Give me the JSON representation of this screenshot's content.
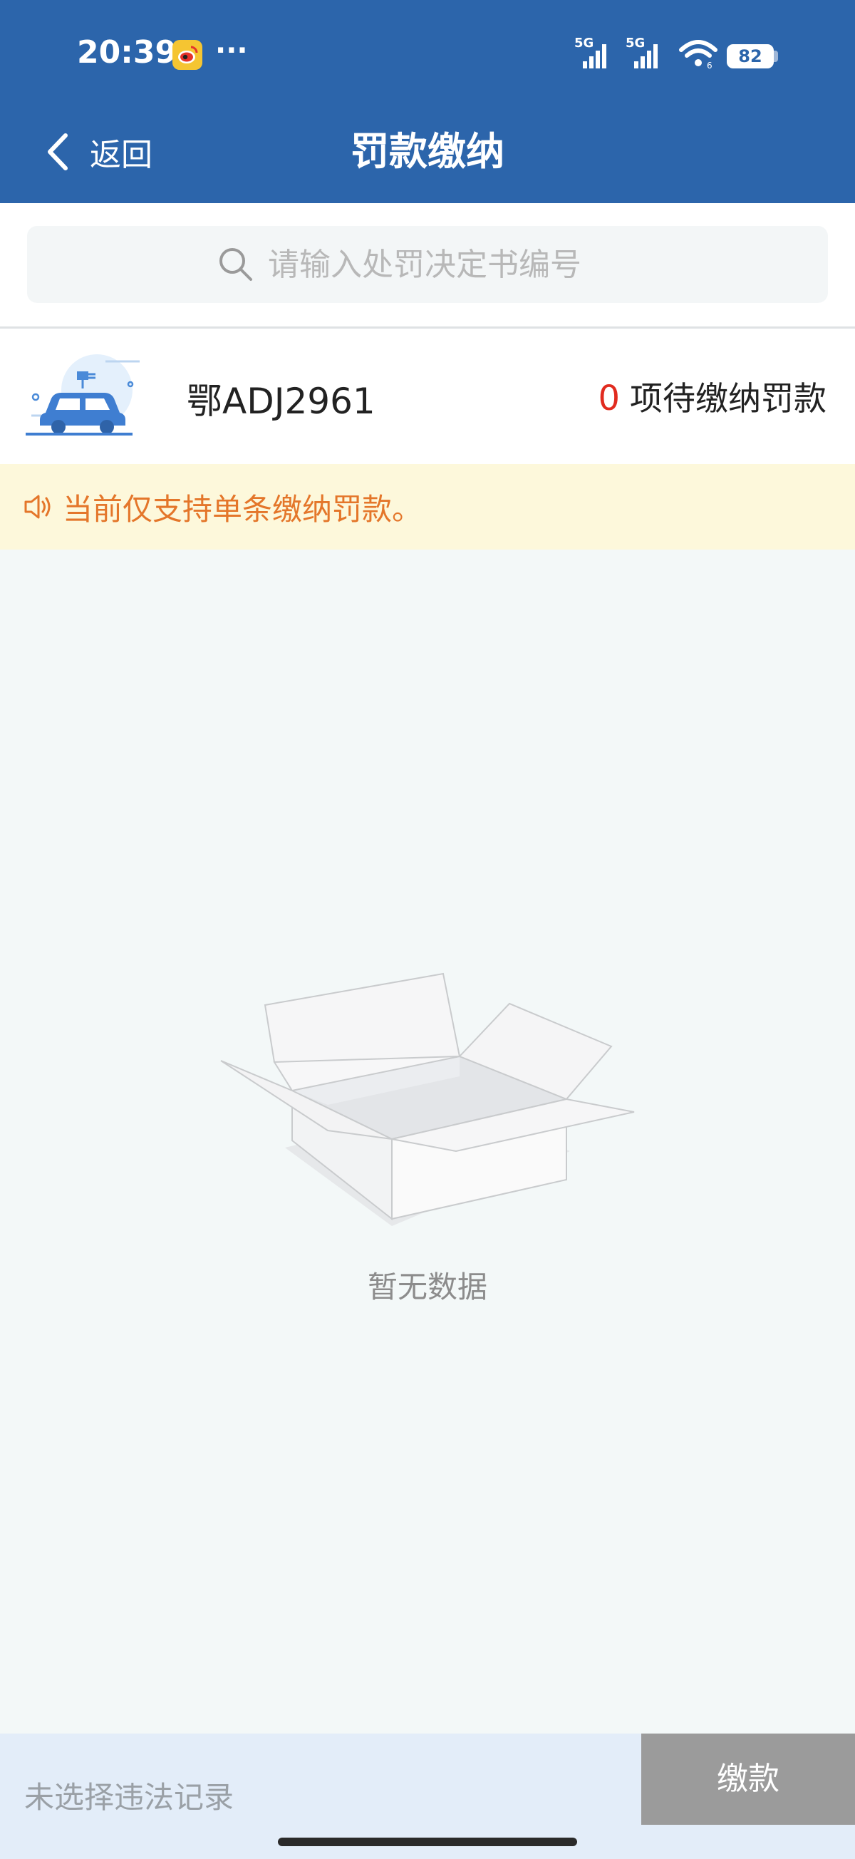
{
  "status_bar": {
    "time": "20:39",
    "notification_icon": "weibo-icon",
    "more_indicator": "···",
    "network_1": "5G",
    "network_2": "5G",
    "battery": "82"
  },
  "nav": {
    "back_label": "返回",
    "title": "罚款缴纳"
  },
  "search": {
    "placeholder": "请输入处罚决定书编号"
  },
  "vehicle": {
    "plate": "鄂ADJ2961",
    "pending_count": "0",
    "pending_label": "项待缴纳罚款"
  },
  "notice": {
    "text": "当前仅支持单条缴纳罚款。"
  },
  "empty_state": {
    "text": "暂无数据"
  },
  "bottom_bar": {
    "selection_status": "未选择违法记录",
    "pay_label": "缴款"
  },
  "colors": {
    "header_bg": "#2c65ab",
    "pending_count": "#e12b1f",
    "notice_bg": "#fdf8db",
    "notice_text": "#e4762a",
    "pay_button_bg": "#9b9b9b"
  }
}
